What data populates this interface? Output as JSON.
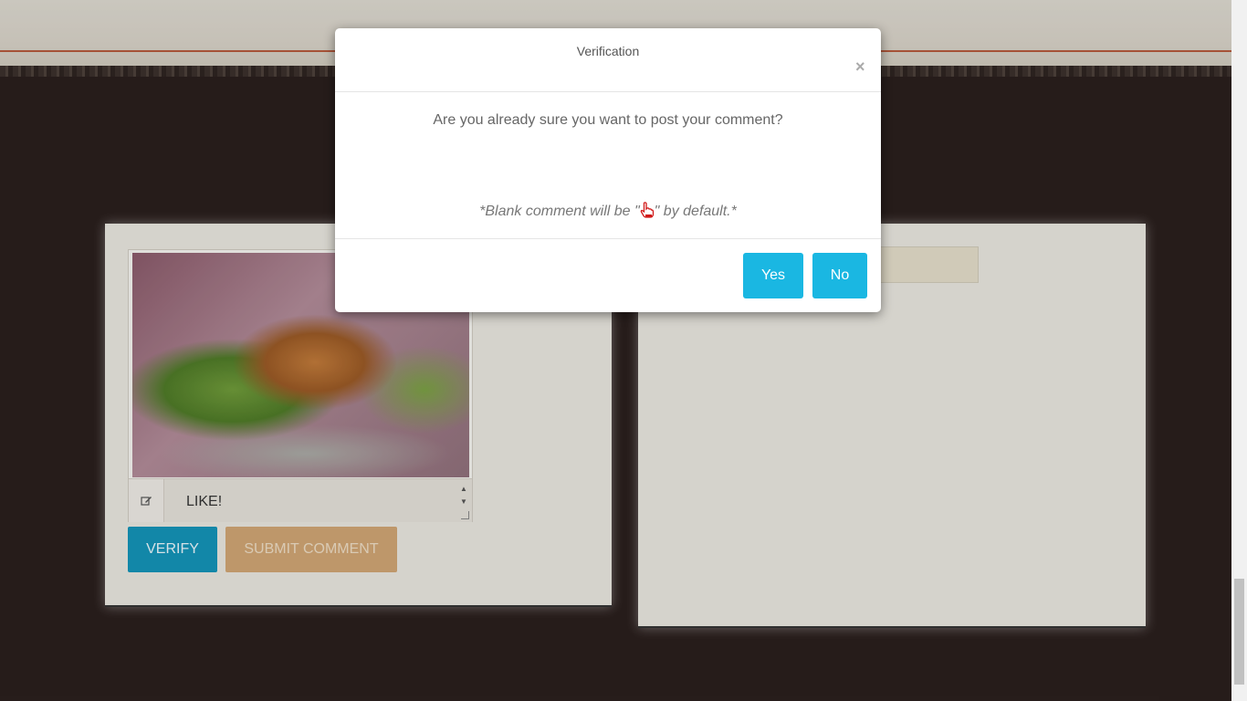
{
  "page": {
    "comment_value": "LIKE!",
    "verify_label": "VERIFY",
    "submit_label": "SUBMIT COMMENT"
  },
  "modal": {
    "title": "Verification",
    "close_glyph": "×",
    "question": "Are you already sure you want to post your comment?",
    "note_prefix": "*Blank comment will be \"",
    "note_suffix": "\" by default.*",
    "yes_label": "Yes",
    "no_label": "No"
  },
  "icons": {
    "edit": "edit-icon",
    "hand": "pointing-hand-icon",
    "close": "close-icon"
  },
  "colors": {
    "accent": "#1ab7e2",
    "verify": "#1493b7",
    "submit": "#cfa473",
    "page_bg": "#2a1f1d"
  }
}
